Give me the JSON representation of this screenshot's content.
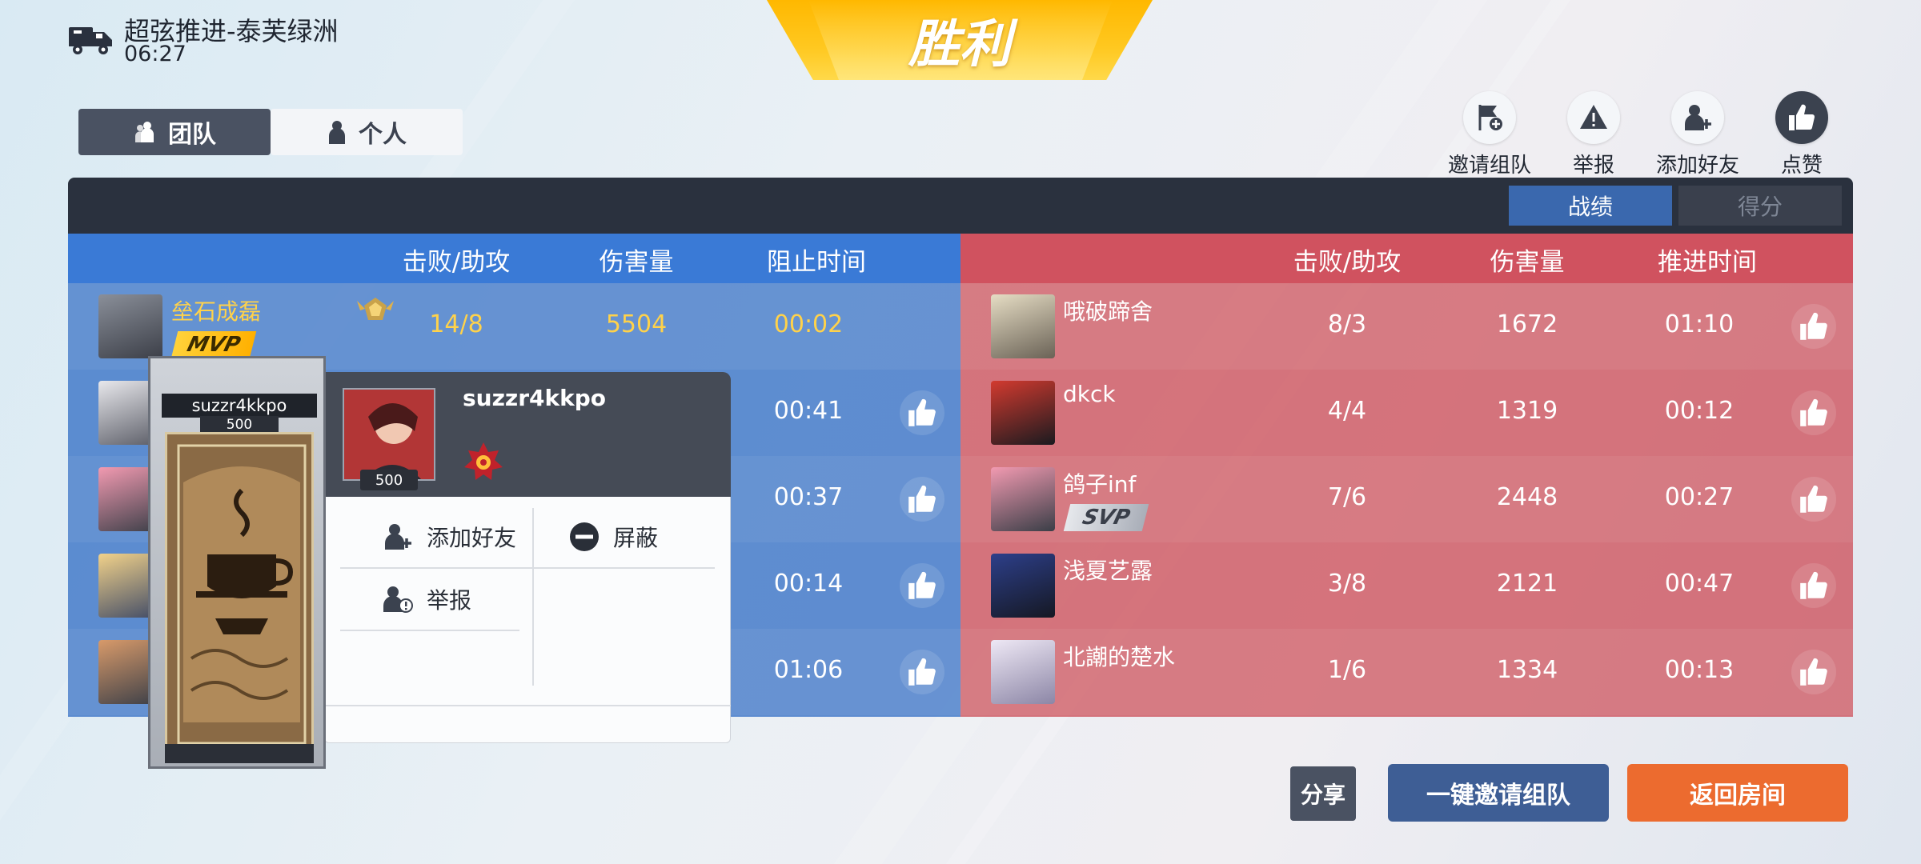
{
  "match": {
    "mode_title": "超弦推进-泰芙绿洲",
    "time": "06:27",
    "result": "胜利"
  },
  "tabs": [
    {
      "label": "团队"
    },
    {
      "label": "个人"
    }
  ],
  "actions": [
    {
      "label": "邀请组队"
    },
    {
      "label": "举报"
    },
    {
      "label": "添加好友"
    },
    {
      "label": "点赞"
    }
  ],
  "segments": {
    "record": "战绩",
    "score": "得分"
  },
  "blue_team": {
    "headers": {
      "kda": "击败/助攻",
      "damage": "伤害量",
      "time": "阻止时间"
    },
    "players": [
      {
        "name": "垒石成磊",
        "kda": "14/8",
        "damage": "5504",
        "time": "00:02",
        "badge": "MVP"
      },
      {
        "time": "00:41"
      },
      {
        "time": "00:37"
      },
      {
        "time": "00:14"
      },
      {
        "time": "01:06"
      }
    ]
  },
  "red_team": {
    "headers": {
      "kda": "击败/助攻",
      "damage": "伤害量",
      "time": "推进时间"
    },
    "players": [
      {
        "name": "哦破蹄舍",
        "kda": "8/3",
        "damage": "1672",
        "time": "01:10"
      },
      {
        "name": "dkck",
        "kda": "4/4",
        "damage": "1319",
        "time": "00:12"
      },
      {
        "name": "鸽子inf",
        "kda": "7/6",
        "damage": "2448",
        "time": "00:27",
        "badge": "SVP"
      },
      {
        "name": "浅夏艺露",
        "kda": "3/8",
        "damage": "2121",
        "time": "00:47"
      },
      {
        "name": "北謿的楚水",
        "kda": "1/6",
        "damage": "1334",
        "time": "00:13"
      }
    ]
  },
  "popup": {
    "name": "suzzr4kkpo",
    "level": "500",
    "card_name": "suzzr4kkpo",
    "card_level": "500",
    "menu": {
      "add_friend": "添加好友",
      "block": "屏蔽",
      "report": "举报"
    }
  },
  "buttons": {
    "share": "分享",
    "invite_all": "一键邀请组队",
    "back": "返回房间"
  }
}
